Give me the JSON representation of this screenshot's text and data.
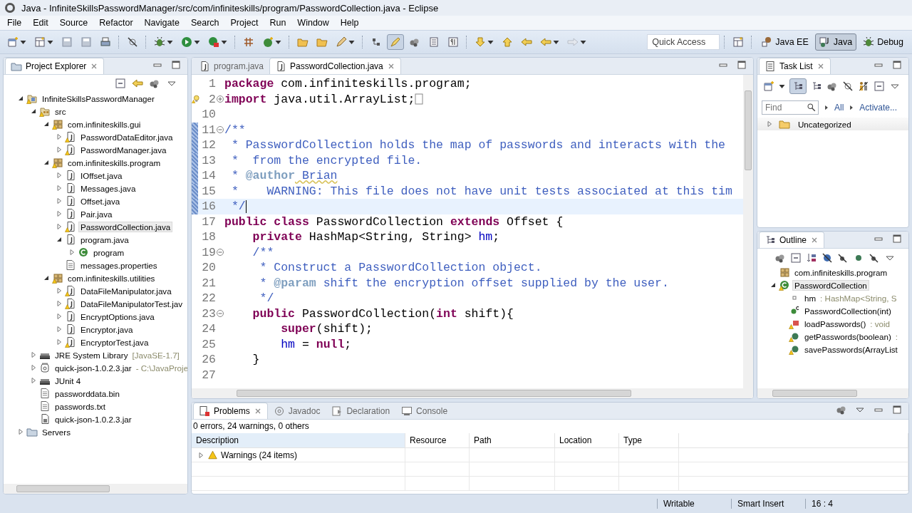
{
  "window": {
    "title": "Java - InfiniteSkillsPasswordManager/src/com/infiniteskills/program/PasswordCollection.java - Eclipse"
  },
  "menu": [
    "File",
    "Edit",
    "Source",
    "Refactor",
    "Navigate",
    "Search",
    "Project",
    "Run",
    "Window",
    "Help"
  ],
  "toolbar": {
    "toggle_on": true
  },
  "quick_access": {
    "placeholder": "Quick Access"
  },
  "perspectives": [
    {
      "label": "Java EE",
      "selected": false
    },
    {
      "label": "Java",
      "selected": true
    },
    {
      "label": "Debug",
      "selected": false
    }
  ],
  "project_explorer": {
    "title": "Project Explorer",
    "tree": [
      {
        "label": "InfiniteSkillsPasswordManager",
        "kind": "project",
        "warning": true,
        "expanded": true,
        "selected": false,
        "children": [
          {
            "label": "src",
            "kind": "source-folder",
            "warning": true,
            "expanded": true,
            "selected": false,
            "children": [
              {
                "label": "com.infiniteskills.gui",
                "kind": "package",
                "warning": true,
                "expanded": true,
                "selected": false,
                "children": [
                  {
                    "label": "PasswordDataEditor.java",
                    "kind": "java",
                    "warning": true,
                    "expanded": false,
                    "selected": false
                  },
                  {
                    "label": "PasswordManager.java",
                    "kind": "java",
                    "warning": true,
                    "expanded": false,
                    "selected": false
                  }
                ]
              },
              {
                "label": "com.infiniteskills.program",
                "kind": "package",
                "warning": true,
                "expanded": true,
                "selected": false,
                "children": [
                  {
                    "label": "IOffset.java",
                    "kind": "java",
                    "warning": false,
                    "expanded": false,
                    "selected": false
                  },
                  {
                    "label": "Messages.java",
                    "kind": "java",
                    "warning": false,
                    "expanded": false,
                    "selected": false
                  },
                  {
                    "label": "Offset.java",
                    "kind": "java",
                    "warning": false,
                    "expanded": false,
                    "selected": false
                  },
                  {
                    "label": "Pair.java",
                    "kind": "java",
                    "warning": false,
                    "expanded": false,
                    "selected": false
                  },
                  {
                    "label": "PasswordCollection.java",
                    "kind": "java",
                    "warning": true,
                    "expanded": false,
                    "selected": true
                  },
                  {
                    "label": "program.java",
                    "kind": "java",
                    "warning": false,
                    "expanded": true,
                    "selected": false,
                    "children": [
                      {
                        "label": "program",
                        "kind": "class",
                        "warning": false,
                        "expanded": false,
                        "selected": false
                      }
                    ]
                  },
                  {
                    "label": "messages.properties",
                    "kind": "file",
                    "warning": false,
                    "selected": false
                  }
                ]
              },
              {
                "label": "com.infiniteskills.utilities",
                "kind": "package",
                "warning": true,
                "expanded": true,
                "selected": false,
                "children": [
                  {
                    "label": "DataFileManipulator.java",
                    "kind": "java",
                    "warning": true,
                    "expanded": false,
                    "selected": false
                  },
                  {
                    "label": "DataFileManipulatorTest.jav",
                    "kind": "java",
                    "warning": true,
                    "expanded": false,
                    "selected": false
                  },
                  {
                    "label": "EncryptOptions.java",
                    "kind": "java",
                    "warning": false,
                    "expanded": false,
                    "selected": false
                  },
                  {
                    "label": "Encryptor.java",
                    "kind": "java",
                    "warning": false,
                    "expanded": false,
                    "selected": false
                  },
                  {
                    "label": "EncryptorTest.java",
                    "kind": "java",
                    "warning": true,
                    "expanded": false,
                    "selected": false
                  }
                ]
              }
            ]
          },
          {
            "label": "JRE System Library",
            "suffix": "[JavaSE-1.7]",
            "kind": "library",
            "warning": false,
            "expanded": false,
            "selected": false
          },
          {
            "label": "quick-json-1.0.2.3.jar",
            "suffix": "- C:\\JavaProje",
            "kind": "jar",
            "warning": false,
            "expanded": false,
            "selected": false
          },
          {
            "label": "JUnit 4",
            "kind": "library",
            "warning": false,
            "expanded": false,
            "selected": false
          },
          {
            "label": "passworddata.bin",
            "kind": "file",
            "warning": false,
            "selected": false
          },
          {
            "label": "passwords.txt",
            "kind": "file",
            "warning": false,
            "selected": false
          },
          {
            "label": "quick-json-1.0.2.3.jar",
            "kind": "jar-file",
            "warning": false,
            "selected": false
          }
        ]
      },
      {
        "label": "Servers",
        "kind": "folder",
        "warning": false,
        "expanded": false,
        "selected": false
      }
    ]
  },
  "editor": {
    "tabs": [
      {
        "label": "program.java",
        "selected": false
      },
      {
        "label": "PasswordCollection.java",
        "selected": true
      }
    ],
    "lines": [
      {
        "number": "1",
        "tokens": [
          {
            "kind": "keyword",
            "text": "package"
          },
          {
            "kind": "plain",
            "text": " com.infiniteskills.program;"
          }
        ]
      },
      {
        "number": "2",
        "folded": true,
        "warning": true,
        "tokens": [
          {
            "kind": "keyword",
            "text": "import"
          },
          {
            "kind": "plain",
            "text": " java.util.ArrayList;"
          }
        ]
      },
      {
        "number": "10"
      },
      {
        "number": "11",
        "folded": false,
        "range": true,
        "tokens": [
          {
            "kind": "comment",
            "text": "/**"
          }
        ]
      },
      {
        "number": "12",
        "range": true,
        "tokens": [
          {
            "kind": "comment",
            "text": " * PasswordCollection holds the map of passwords and interacts with the"
          }
        ]
      },
      {
        "number": "13",
        "range": true,
        "tokens": [
          {
            "kind": "comment",
            "text": " *  from the encrypted file."
          }
        ]
      },
      {
        "number": "14",
        "range": true,
        "tokens": [
          {
            "kind": "comment",
            "text": " * "
          },
          {
            "kind": "tag",
            "text": "@author"
          },
          {
            "kind": "misspelled",
            "text": " Brian"
          }
        ]
      },
      {
        "number": "15",
        "range": true,
        "tokens": [
          {
            "kind": "comment",
            "text": " *    WARNING: This file does not have unit tests associated at this tim"
          }
        ]
      },
      {
        "number": "16",
        "range": true,
        "current": true,
        "tokens": [
          {
            "kind": "comment",
            "text": " */"
          }
        ]
      },
      {
        "number": "17",
        "current": false,
        "tokens": [
          {
            "kind": "keyword",
            "text": "public class"
          },
          {
            "kind": "plain",
            "text": " PasswordCollection "
          },
          {
            "kind": "keyword",
            "text": "extends"
          },
          {
            "kind": "plain",
            "text": " Offset {"
          }
        ]
      },
      {
        "number": "18",
        "tokens": [
          {
            "kind": "keyword",
            "text": "    private"
          },
          {
            "kind": "plain",
            "text": " HashMap<String, String> "
          },
          {
            "kind": "field",
            "text": "hm"
          },
          {
            "kind": "plain",
            "text": ";"
          }
        ]
      },
      {
        "number": "19",
        "folded": false,
        "tokens": [
          {
            "kind": "comment",
            "text": "    /**"
          }
        ]
      },
      {
        "number": "20",
        "tokens": [
          {
            "kind": "comment",
            "text": "     * Construct a PasswordCollection object."
          }
        ]
      },
      {
        "number": "21",
        "tokens": [
          {
            "kind": "comment",
            "text": "     * "
          },
          {
            "kind": "tag",
            "text": "@param"
          },
          {
            "kind": "comment",
            "text": " shift the encryption offset supplied by the user."
          }
        ]
      },
      {
        "number": "22",
        "tokens": [
          {
            "kind": "comment",
            "text": "     */"
          }
        ]
      },
      {
        "number": "23",
        "folded": false,
        "tokens": [
          {
            "kind": "keyword",
            "text": "    public"
          },
          {
            "kind": "plain",
            "text": " PasswordCollection("
          },
          {
            "kind": "keyword",
            "text": "int"
          },
          {
            "kind": "plain",
            "text": " shift){"
          }
        ]
      },
      {
        "number": "24",
        "tokens": [
          {
            "kind": "keyword",
            "text": "        super"
          },
          {
            "kind": "plain",
            "text": "(shift);"
          }
        ]
      },
      {
        "number": "25",
        "tokens": [
          {
            "kind": "field",
            "text": "        hm"
          },
          {
            "kind": "plain",
            "text": " = "
          },
          {
            "kind": "keyword",
            "text": "null"
          },
          {
            "kind": "plain",
            "text": ";"
          }
        ]
      },
      {
        "number": "26",
        "tokens": [
          {
            "kind": "plain",
            "text": "    }"
          }
        ]
      },
      {
        "number": "27"
      }
    ]
  },
  "task_list": {
    "title": "Task List",
    "toggle_on": true,
    "find": {
      "placeholder": "Find"
    },
    "links": [
      "All",
      "Activate..."
    ],
    "items": [
      {
        "label": "Uncategorized",
        "expanded": false
      }
    ]
  },
  "outline": {
    "title": "Outline",
    "tree": [
      {
        "label": "com.infiniteskills.program",
        "kind": "package-decl",
        "warning": false,
        "selected": false
      },
      {
        "label": "PasswordCollection",
        "kind": "class",
        "warning": true,
        "expanded": true,
        "selected": true,
        "children": [
          {
            "label": "hm",
            "suffix": " : HashMap<String, S",
            "kind": "field",
            "warning": false,
            "selected": false
          },
          {
            "label": "PasswordCollection(int)",
            "kind": "constructor",
            "warning": false,
            "selected": false
          },
          {
            "label": "loadPasswords()",
            "suffix": " : void",
            "kind": "private-method",
            "warning": true,
            "selected": false
          },
          {
            "label": "getPasswords(boolean)",
            "suffix": " :",
            "kind": "method",
            "warning": true,
            "selected": false
          },
          {
            "label": "savePasswords(ArrayList",
            "kind": "method",
            "warning": true,
            "selected": false
          }
        ]
      }
    ]
  },
  "problems": {
    "tabs": [
      {
        "label": "Problems",
        "selected": true
      },
      {
        "label": "Javadoc",
        "selected": false
      },
      {
        "label": "Declaration",
        "selected": false
      },
      {
        "label": "Console",
        "selected": false
      }
    ],
    "summary": "0 errors, 24 warnings, 0 others",
    "columns": [
      "Description",
      "Resource",
      "Path",
      "Location",
      "Type"
    ],
    "rows": [
      {
        "description": "Warnings (24 items)",
        "expanded": false
      }
    ]
  },
  "status_bar": [
    "Writable",
    "Smart Insert",
    "16 : 4"
  ]
}
